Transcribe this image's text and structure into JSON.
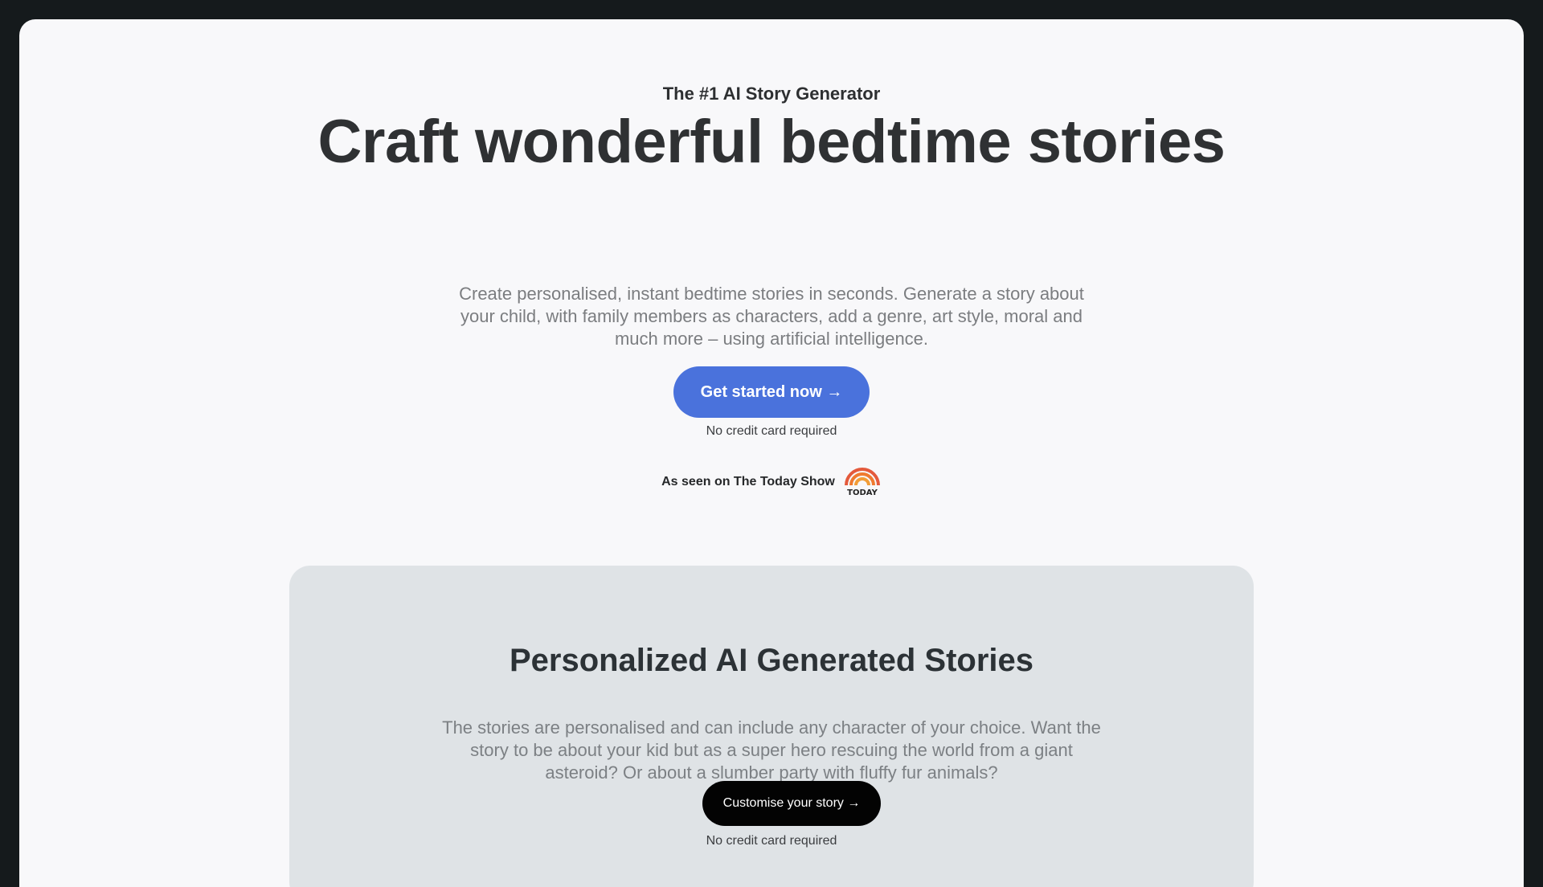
{
  "hero": {
    "eyebrow": "The #1 AI Story Generator",
    "headline": "Craft wonderful bedtime stories",
    "subtitle": "Create personalised, instant bedtime stories in seconds. Generate a story about your child, with family members as characters, add a genre, art style, moral and much more – using artificial intelligence.",
    "cta_label": "Get started now →",
    "cta_note": "No credit card required",
    "seen_on": "As seen on The Today Show",
    "logo_text": "TODAY"
  },
  "feature": {
    "title": "Personalized AI Generated Stories",
    "text": "The stories are personalised and can include any character of your choice. Want the story to be about your kid but as a super hero rescuing the world from a giant asteroid? Or about a slumber party with fluffy fur animals?",
    "cta_label": "Customise your story →",
    "cta_note": "No credit card required"
  },
  "colors": {
    "page_background": "#151a1c",
    "card_background": "#f8f8fa",
    "panel_background": "#dfe3e6",
    "primary_button": "#4a72dc",
    "secondary_button": "#030303",
    "today_logo": "#e45a3c"
  }
}
